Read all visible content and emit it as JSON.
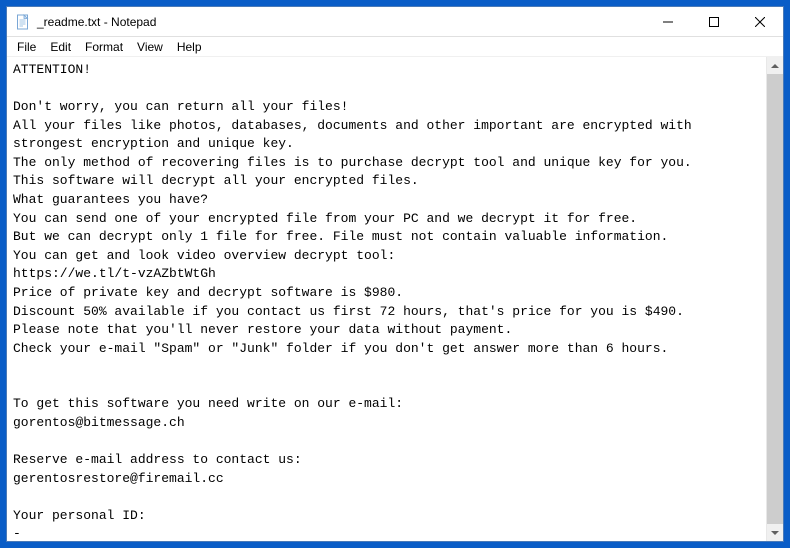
{
  "window": {
    "title": "_readme.txt - Notepad"
  },
  "menu": {
    "file": "File",
    "edit": "Edit",
    "format": "Format",
    "view": "View",
    "help": "Help"
  },
  "document": {
    "body": "ATTENTION!\n\nDon't worry, you can return all your files!\nAll your files like photos, databases, documents and other important are encrypted with strongest encryption and unique key.\nThe only method of recovering files is to purchase decrypt tool and unique key for you.\nThis software will decrypt all your encrypted files.\nWhat guarantees you have?\nYou can send one of your encrypted file from your PC and we decrypt it for free.\nBut we can decrypt only 1 file for free. File must not contain valuable information.\nYou can get and look video overview decrypt tool:\nhttps://we.tl/t-vzAZbtWtGh\nPrice of private key and decrypt software is $980.\nDiscount 50% available if you contact us first 72 hours, that's price for you is $490.\nPlease note that you'll never restore your data without payment.\nCheck your e-mail \"Spam\" or \"Junk\" folder if you don't get answer more than 6 hours.\n\n\nTo get this software you need write on our e-mail:\ngorentos@bitmessage.ch\n\nReserve e-mail address to contact us:\ngerentosrestore@firemail.cc\n\nYour personal ID:\n-"
  }
}
